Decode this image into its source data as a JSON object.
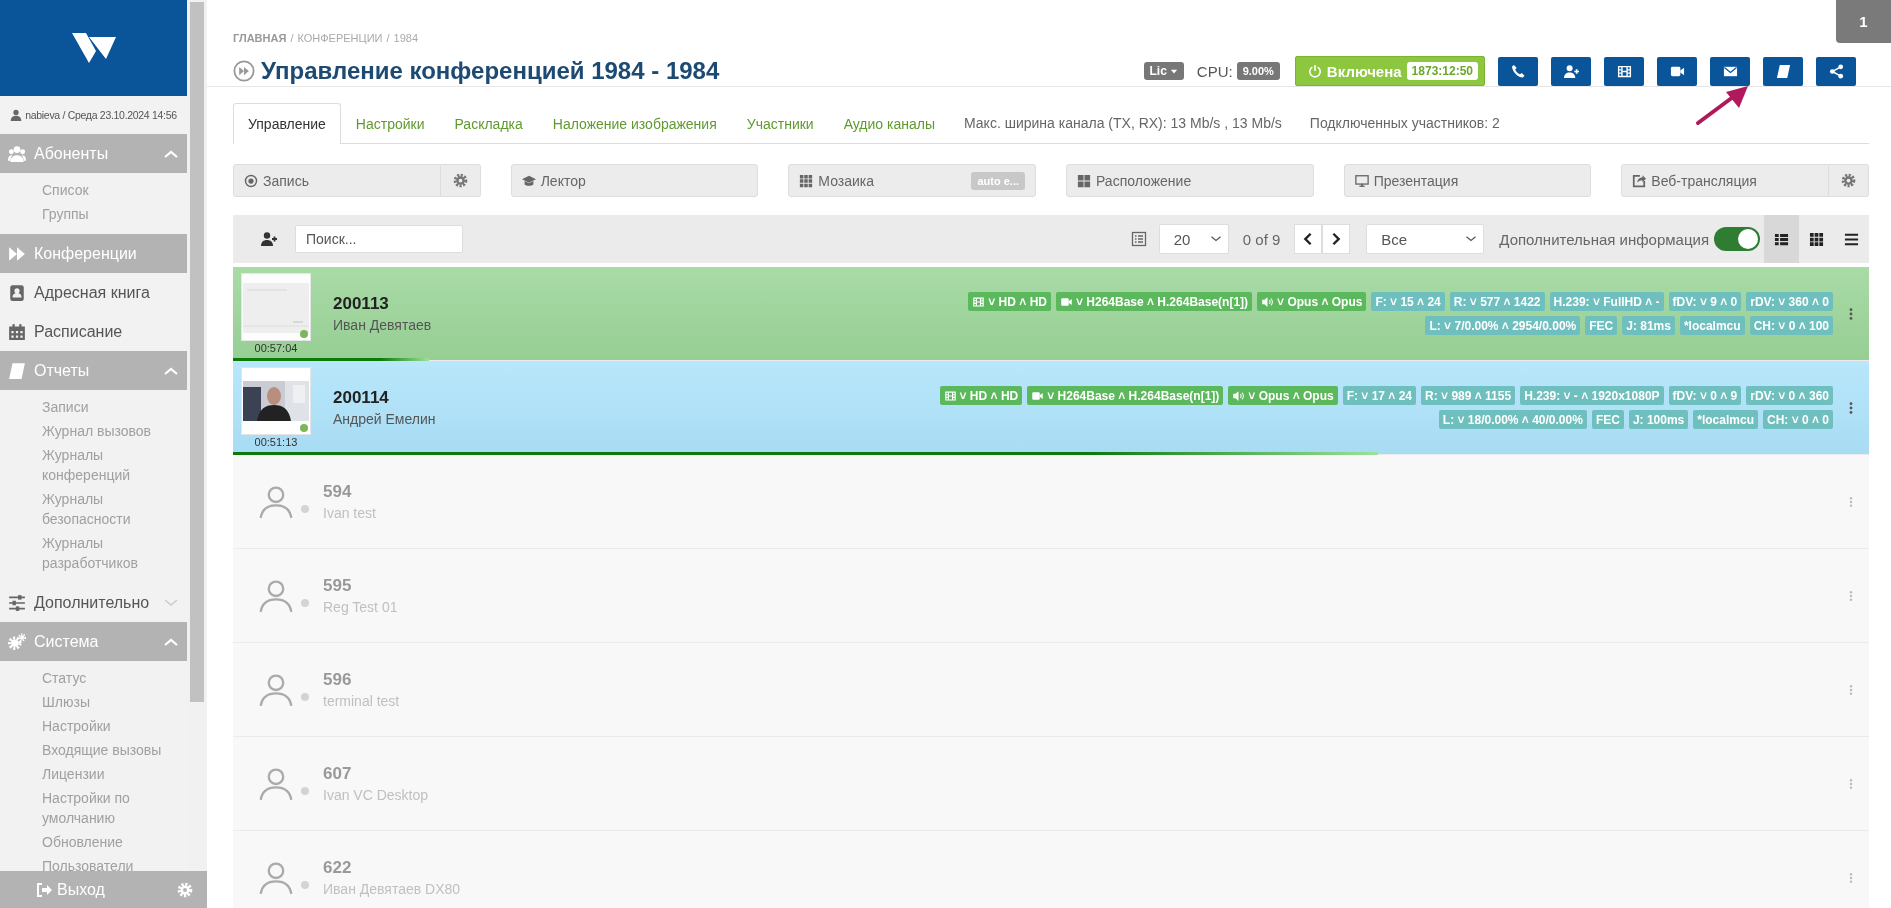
{
  "sidebar": {
    "user": "nabieva / Среда 23.10.2024 14:56",
    "sections": [
      {
        "kind": "group",
        "label": "Абоненты",
        "expanded": true,
        "children": [
          {
            "label": "Список"
          },
          {
            "label": "Группы"
          }
        ]
      },
      {
        "kind": "link",
        "label": "Конференции",
        "selected": true
      },
      {
        "kind": "link",
        "label": "Адресная книга",
        "selected": false
      },
      {
        "kind": "link",
        "label": "Расписание",
        "selected": false
      },
      {
        "kind": "group",
        "label": "Отчеты",
        "expanded": true,
        "children": [
          {
            "label": "Записи"
          },
          {
            "label": "Журнал вызовов"
          },
          {
            "label": "Журналы конференций"
          },
          {
            "label": "Журналы безопасности"
          },
          {
            "label": "Журналы разработчиков"
          }
        ]
      },
      {
        "kind": "group",
        "label": "Дополнительно",
        "expanded": false
      },
      {
        "kind": "group",
        "label": "Система",
        "expanded": true,
        "children": [
          {
            "label": "Статус"
          },
          {
            "label": "Шлюзы"
          },
          {
            "label": "Настройки"
          },
          {
            "label": "Входящие вызовы"
          },
          {
            "label": "Лицензии"
          },
          {
            "label": "Настройки по умолчанию"
          },
          {
            "label": "Обновление"
          },
          {
            "label": "Пользователи"
          }
        ]
      }
    ],
    "logout": "Выход"
  },
  "breadcrumb": [
    {
      "kind": "home",
      "text": "ГЛАВНАЯ"
    },
    {
      "kind": "separator",
      "text": "/"
    },
    {
      "kind": "link",
      "text": "КОНФЕРЕНЦИИ"
    },
    {
      "kind": "separator",
      "text": "/"
    },
    {
      "kind": "current",
      "text": "1984"
    }
  ],
  "title": "Управление конференцией 1984 - 1984",
  "header": {
    "license": "Lic",
    "cpu_label": "CPU:",
    "cpu_value": "9.00%",
    "power": {
      "label": "Включена",
      "on": true,
      "uptime": "1873:12:50"
    }
  },
  "notification_badge": "1",
  "tabs": [
    {
      "label": "Управление",
      "selected": true
    },
    {
      "label": "Настройки",
      "selected": false
    },
    {
      "label": "Раскладка",
      "selected": false
    },
    {
      "label": "Наложение изображения",
      "selected": false
    },
    {
      "label": "Участники",
      "selected": false
    },
    {
      "label": "Аудио каналы",
      "selected": false
    }
  ],
  "tab_info": [
    "Макс. ширина канала (TX, RX): 13 Mb/s , 13 Mb/s",
    "Подключенных участников: 2"
  ],
  "controls": [
    {
      "label": "Запись",
      "settings": true
    },
    {
      "label": "Лектор",
      "settings": false
    },
    {
      "label": "Мозаика",
      "settings": false,
      "tag": "auto e..."
    },
    {
      "label": "Расположение",
      "settings": false
    },
    {
      "label": "Презентация",
      "settings": false
    },
    {
      "label": "Веб-трансляция",
      "settings": true
    }
  ],
  "toolbar": {
    "search": {
      "placeholder": "Поиск..."
    },
    "page_size": "20",
    "page_info": "0 of 9",
    "filter": "Все",
    "extra_info": {
      "label": "Дополнительная информация",
      "on": true
    },
    "views": [
      {
        "selected": true
      },
      {
        "selected": false
      },
      {
        "selected": false
      }
    ]
  },
  "participants": [
    {
      "kind": "active",
      "color": "#9bd598",
      "number": "200113",
      "name": "Иван Девятаев",
      "time": "00:57:04",
      "status_dot": {
        "color": "#7cb65a"
      },
      "level": 0.12,
      "badge_lines": [
        [
          {
            "kind": "video",
            "text": "˅ HD ˄ HD"
          },
          {
            "kind": "codec",
            "text": "˅ H264Base ˄ H.264Base(n[1])"
          },
          {
            "kind": "audio",
            "text": "˅ Opus ˄ Opus"
          },
          {
            "kind": "stat",
            "text": "F: ˅ 15 ˄ 24"
          },
          {
            "kind": "stat",
            "text": "R: ˅ 577 ˄ 1422"
          },
          {
            "kind": "stat",
            "text": "H.239: ˅ FullHD ˄ -"
          },
          {
            "kind": "stat",
            "text": "fDV: ˅ 9 ˄ 0"
          },
          {
            "kind": "stat",
            "text": "rDV: ˅ 360 ˄ 0"
          }
        ],
        [
          {
            "kind": "stat",
            "text": "L: ˅ 7/0.00% ˄ 2954/0.00%"
          },
          {
            "kind": "stat",
            "text": "FEC"
          },
          {
            "kind": "stat",
            "text": "J: 81ms"
          },
          {
            "kind": "stat",
            "text": "*localmcu"
          },
          {
            "kind": "stat",
            "text": "CH: ˅ 0 ˄ 100"
          }
        ]
      ]
    },
    {
      "kind": "active",
      "color": "#ade3fb",
      "number": "200114",
      "name": "Андрей Емелин",
      "time": "00:51:13",
      "status_dot": {
        "color": "#7cb65a"
      },
      "level": 0.7,
      "badge_lines": [
        [
          {
            "kind": "video",
            "text": "˅ HD ˄ HD"
          },
          {
            "kind": "codec",
            "text": "˅ H264Base ˄ H.264Base(n[1])"
          },
          {
            "kind": "audio",
            "text": "˅ Opus ˄ Opus"
          },
          {
            "kind": "stat",
            "text": "F: ˅ 17 ˄ 24"
          },
          {
            "kind": "stat",
            "text": "R: ˅ 989 ˄ 1155"
          },
          {
            "kind": "stat",
            "text": "H.239: ˅ - ˄ 1920x1080P"
          },
          {
            "kind": "stat",
            "text": "fDV: ˅ 0 ˄ 9"
          },
          {
            "kind": "stat",
            "text": "rDV: ˅ 0 ˄ 360"
          }
        ],
        [
          {
            "kind": "stat",
            "text": "L: ˅ 18/0.00% ˄ 40/0.00%"
          },
          {
            "kind": "stat",
            "text": "FEC"
          },
          {
            "kind": "stat",
            "text": "J: 100ms"
          },
          {
            "kind": "stat",
            "text": "*localmcu"
          },
          {
            "kind": "stat",
            "text": "CH: ˅ 0 ˄ 0"
          }
        ]
      ]
    },
    {
      "kind": "offline",
      "number": "594",
      "name": "Ivan test",
      "status_dot": {
        "color": "#d4d4d4"
      }
    },
    {
      "kind": "offline",
      "number": "595",
      "name": "Reg Test 01",
      "status_dot": {
        "color": "#d4d4d4"
      }
    },
    {
      "kind": "offline",
      "number": "596",
      "name": "terminal test",
      "status_dot": {
        "color": "#d4d4d4"
      }
    },
    {
      "kind": "offline",
      "number": "607",
      "name": "Ivan VC Desktop",
      "status_dot": {
        "color": "#d4d4d4"
      }
    },
    {
      "kind": "offline",
      "number": "622",
      "name": "Иван Девятаев DX80",
      "status_dot": {
        "color": "#d4d4d4"
      }
    }
  ]
}
